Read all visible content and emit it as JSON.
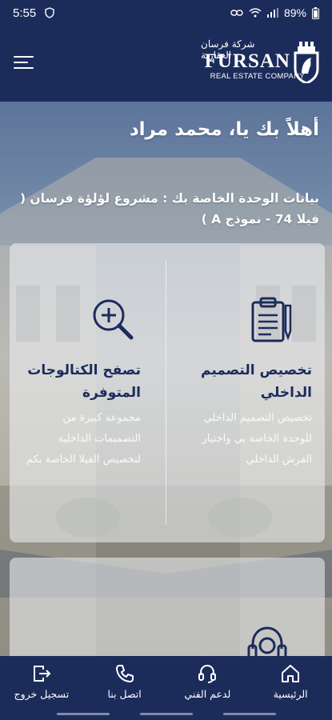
{
  "status_bar": {
    "time": "5:55",
    "battery": "89%",
    "icons": [
      "shield-icon",
      "link-icon",
      "wifi-icon",
      "signal-icon",
      "battery-icon"
    ]
  },
  "app_bar": {
    "logo_arabic": "شركة فرسان العقارية",
    "logo_name": "FURSAN",
    "logo_sub": "REAL ESTATE COMPANY",
    "menu_icon": "menu-icon"
  },
  "welcome": "أهلاً بك يا، محمد مراد",
  "unit_info": "بيانات الوحدة الخاصة بك : مشروع لؤلؤة فرسان ( فيلا 74 - نموذج A )",
  "cards": [
    {
      "icon": "clipboard-icon",
      "title": "تخصيص التصميم الداخلي",
      "description": "تخصيص التصميم الداخلي للوحدة الخاصة بي واختيار الفرش الداخلي"
    },
    {
      "icon": "zoom-in-icon",
      "title": "تصفح الكتالوجات المتوفرة",
      "description": "مجموعة كبيرة من التصميمات الداخلية لتخصيص الفيلا الخاصة بكم"
    },
    {
      "icon": "headset-icon"
    }
  ],
  "bottom_nav": [
    {
      "icon": "home-icon",
      "label": "الرئيسية"
    },
    {
      "icon": "headset-icon",
      "label": "لدعم الفني"
    },
    {
      "icon": "phone-icon",
      "label": "اتصل بنا"
    },
    {
      "icon": "logout-icon",
      "label": "تسجيل خروج"
    }
  ],
  "colors": {
    "primary": "#1b2c5b",
    "card": "#eceef2",
    "text": "#ffffff"
  }
}
